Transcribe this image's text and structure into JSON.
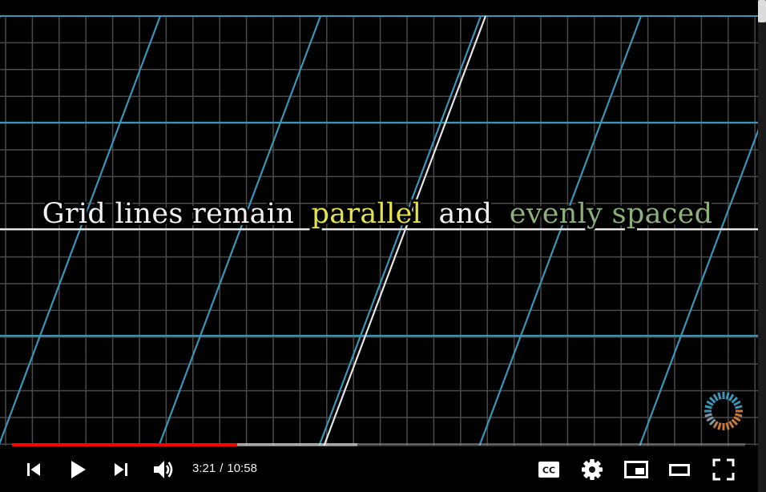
{
  "video": {
    "caption_parts": [
      {
        "text": "Grid lines remain",
        "color": "#f2f2f2"
      },
      {
        "text": "parallel",
        "color": "#e6e34a"
      },
      {
        "text": "and",
        "color": "#f2f2f2"
      },
      {
        "text": "evenly spaced",
        "color": "#8bb07a"
      }
    ],
    "colors": {
      "grid_faint": "#4a4a4a",
      "grid_blue": "#3b95b8",
      "axis_white": "#e6e6e6"
    }
  },
  "player": {
    "progress": {
      "played_fraction": 0.307,
      "buffered_fraction": 0.471,
      "played_color": "#ff0000"
    },
    "time": {
      "current": "3:21",
      "separator": "/",
      "duration": "10:58"
    },
    "controls_left": [
      "previous-icon",
      "play-icon",
      "next-icon",
      "volume-icon"
    ],
    "controls_right": [
      "subtitles-cc-icon",
      "settings-gear-icon",
      "miniplayer-icon",
      "theater-mode-icon",
      "fullscreen-icon"
    ],
    "cc_label": "CC"
  }
}
